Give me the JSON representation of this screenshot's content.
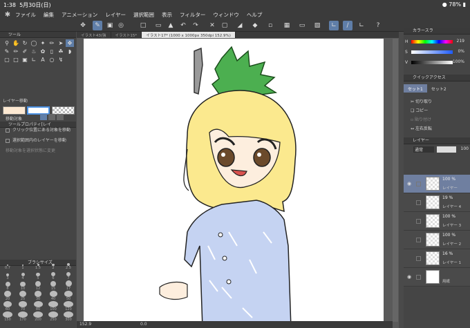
{
  "status": {
    "time": "1:38",
    "date": "5月30日(日)",
    "battery": "78%"
  },
  "menu": [
    "ファイル",
    "編集",
    "アニメーション",
    "レイヤー",
    "選択範囲",
    "表示",
    "フィルター",
    "ウィンドウ",
    "ヘルプ"
  ],
  "left": {
    "tool_header": "ツール",
    "props_header": "ツールプロパティ[レイ",
    "props_title": "レイヤー移動",
    "target_label": "移動対象",
    "options": [
      "クリック位置にある対象を移動",
      "選択範囲内のレイヤーを移動",
      "移動対象を選択状態に変更"
    ],
    "brush_header": "ブラシサイズ",
    "brush_sizes": [
      "0.7",
      "1",
      "1.5",
      "2",
      "2.5",
      "3",
      "4",
      "5",
      "6",
      "7",
      "8",
      "10",
      "12",
      "15",
      "17",
      "20",
      "25",
      "30",
      "40",
      "50",
      "60",
      "70",
      "80",
      "100",
      "120",
      "150",
      "170",
      "200",
      "250",
      "300"
    ]
  },
  "tabs": [
    "イラスト43(強",
    "イラスト15*",
    "イラスト17* (1000 x 1000px 350dpi 152.9%)"
  ],
  "right": {
    "color_header": "カラースラ",
    "sliders": [
      {
        "label": "H",
        "value": "219"
      },
      {
        "label": "S",
        "value": "0%"
      },
      {
        "label": "V",
        "value": "100%"
      }
    ],
    "quick_header": "クイックアクセス",
    "sets": [
      "セット1",
      "セット2"
    ],
    "quick_items": [
      "切り取り",
      "コピー",
      "貼り付け",
      "左右反転"
    ],
    "layer_header": "レイヤー",
    "blend": "通常",
    "opacity": "100",
    "layers": [
      {
        "pct": "100 %",
        "name": "レイヤー",
        "selected": true
      },
      {
        "pct": "19 %",
        "name": "レイヤー 4",
        "selected": false
      },
      {
        "pct": "100 %",
        "name": "レイヤー 3",
        "selected": false
      },
      {
        "pct": "100 %",
        "name": "レイヤー 2",
        "selected": false
      },
      {
        "pct": "16 %",
        "name": "レイヤー 1",
        "selected": false
      },
      {
        "pct": "",
        "name": "用紙",
        "selected": false
      }
    ]
  },
  "bottom": {
    "zoom": "152.9",
    "rot": "0.0"
  }
}
